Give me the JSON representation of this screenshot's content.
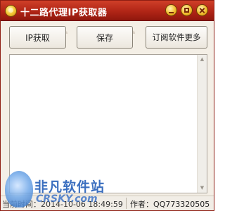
{
  "window": {
    "title": "十二路代理IP获取器"
  },
  "toolbar": {
    "get_ip_label": "IP获取",
    "save_label": "保存",
    "subscribe_label": "订阅软件更多"
  },
  "output": {
    "text": ""
  },
  "statusbar": {
    "time_text": "当前时间：2014-10-06 18:49:59",
    "author_text": "作者：QQ773320505"
  },
  "watermark": {
    "brand_cn": "非凡软件站",
    "brand_en": "CRSKY.com"
  },
  "colors": {
    "titlebar": "#b02516",
    "window_bg": "#f4efe6",
    "watermark_blue": "#1a56b5"
  },
  "icons": {
    "app": "gold-coin-icon",
    "minimize": "minimize-icon",
    "maximize": "maximize-icon",
    "close": "close-icon"
  }
}
